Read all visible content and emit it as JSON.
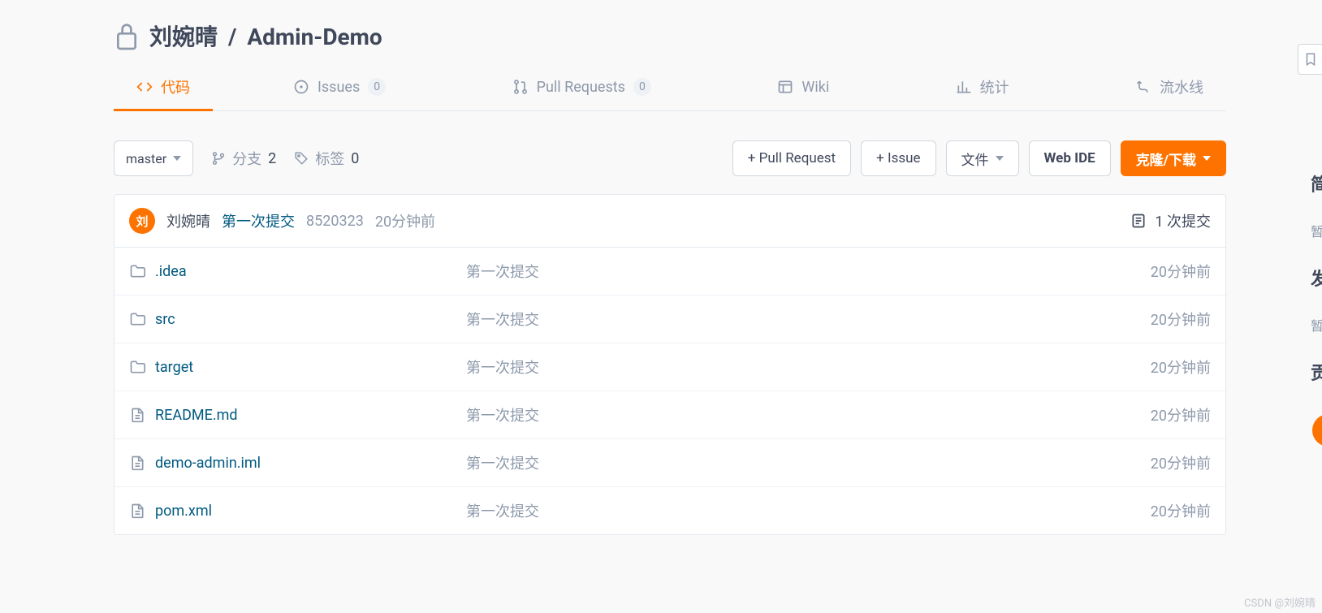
{
  "breadcrumb": {
    "owner": "刘婉晴",
    "sep": "/",
    "name": "Admin-Demo"
  },
  "tabs": {
    "code": "代码",
    "issues": {
      "label": "Issues",
      "count": "0"
    },
    "pulls": {
      "label": "Pull Requests",
      "count": "0"
    },
    "wiki": "Wiki",
    "stats": "统计",
    "pipelines": "流水线"
  },
  "toolbar": {
    "branch": "master",
    "branches_label": "分支",
    "branches_count": "2",
    "tags_label": "标签",
    "tags_count": "0",
    "new_pr": "+ Pull Request",
    "new_issue": "+ Issue",
    "files_label": "文件",
    "web_ide": "Web IDE",
    "clone": "克隆/下载"
  },
  "last_commit": {
    "avatar_text": "刘",
    "author": "刘婉晴",
    "message": "第一次提交",
    "sha": "8520323",
    "time": "20分钟前",
    "commits_count": "1 次提交"
  },
  "files": [
    {
      "kind": "folder",
      "name": ".idea",
      "msg": "第一次提交",
      "time": "20分钟前"
    },
    {
      "kind": "folder",
      "name": "src",
      "msg": "第一次提交",
      "time": "20分钟前"
    },
    {
      "kind": "folder",
      "name": "target",
      "msg": "第一次提交",
      "time": "20分钟前"
    },
    {
      "kind": "file",
      "name": "README.md",
      "msg": "第一次提交",
      "time": "20分钟前"
    },
    {
      "kind": "file",
      "name": "demo-admin.iml",
      "msg": "第一次提交",
      "time": "20分钟前"
    },
    {
      "kind": "file",
      "name": "pom.xml",
      "msg": "第一次提交",
      "time": "20分钟前"
    }
  ],
  "right_panel": {
    "intro_heading": "简",
    "intro_empty": "暂",
    "release_heading": "发",
    "release_empty": "暂",
    "contrib_heading": "贡"
  },
  "watermark": "CSDN @刘婉晴"
}
